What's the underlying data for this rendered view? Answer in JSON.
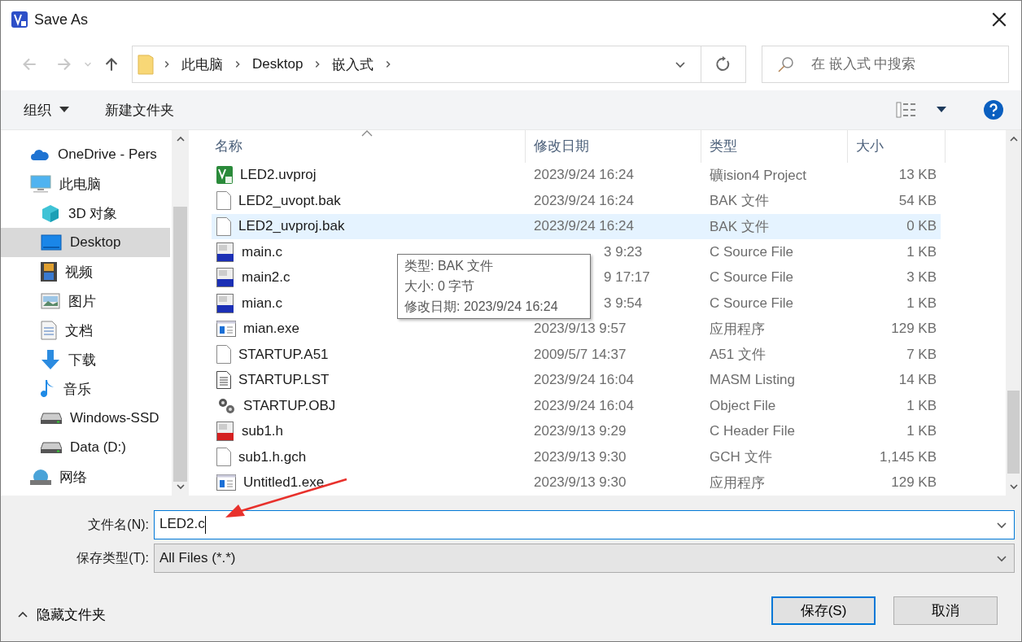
{
  "window": {
    "title": "Save As"
  },
  "address": {
    "path": [
      "此电脑",
      "Desktop",
      "嵌入式"
    ]
  },
  "search": {
    "placeholder": "在 嵌入式 中搜索"
  },
  "toolbar": {
    "organize": "组织",
    "new_folder": "新建文件夹"
  },
  "sidebar": {
    "items": [
      {
        "label": "OneDrive - Pers",
        "kind": "cloud",
        "selected": false
      },
      {
        "label": "此电脑",
        "kind": "pc",
        "selected": false,
        "children": [
          {
            "label": "3D 对象",
            "kind": "cube",
            "selected": false
          },
          {
            "label": "Desktop",
            "kind": "desktop",
            "selected": true
          },
          {
            "label": "视频",
            "kind": "video",
            "selected": false
          },
          {
            "label": "图片",
            "kind": "pictures",
            "selected": false
          },
          {
            "label": "文档",
            "kind": "documents",
            "selected": false
          },
          {
            "label": "下载",
            "kind": "download",
            "selected": false
          },
          {
            "label": "音乐",
            "kind": "music",
            "selected": false
          },
          {
            "label": "Windows-SSD",
            "kind": "drive",
            "selected": false
          },
          {
            "label": "Data (D:)",
            "kind": "drive",
            "selected": false
          }
        ]
      },
      {
        "label": "网络",
        "kind": "network",
        "selected": false
      }
    ]
  },
  "table": {
    "columns": [
      {
        "label": "名称",
        "sorted": true
      },
      {
        "label": "修改日期"
      },
      {
        "label": "类型"
      },
      {
        "label": "大小"
      }
    ],
    "rows": [
      {
        "name": "LED2.uvproj",
        "date": "2023/9/24 16:24",
        "type": "礦ision4 Project",
        "size": "13 KB",
        "kind": "project",
        "selected": false,
        "partly_hidden": false
      },
      {
        "name": "LED2_uvopt.bak",
        "date": "2023/9/24 16:24",
        "type": "BAK 文件",
        "size": "54 KB",
        "kind": "blank",
        "selected": false,
        "partly_hidden": false
      },
      {
        "name": "LED2_uvproj.bak",
        "date": "2023/9/24 16:24",
        "type": "BAK 文件",
        "size": "0 KB",
        "kind": "blank",
        "selected": true,
        "partly_hidden": false
      },
      {
        "name": "main.c",
        "date": "3 9:23",
        "type": "C Source File",
        "size": "1 KB",
        "kind": "source",
        "selected": false,
        "partly_hidden": true
      },
      {
        "name": "main2.c",
        "date": "9 17:17",
        "type": "C Source File",
        "size": "3 KB",
        "kind": "source",
        "selected": false,
        "partly_hidden": true
      },
      {
        "name": "mian.c",
        "date": "3 9:54",
        "type": "C Source File",
        "size": "1 KB",
        "kind": "source",
        "selected": false,
        "partly_hidden": true
      },
      {
        "name": "mian.exe",
        "date": "2023/9/13 9:57",
        "type": "应用程序",
        "size": "129 KB",
        "kind": "exe",
        "selected": false,
        "partly_hidden": false
      },
      {
        "name": "STARTUP.A51",
        "date": "2009/5/7 14:37",
        "type": "A51 文件",
        "size": "7 KB",
        "kind": "blank",
        "selected": false,
        "partly_hidden": false
      },
      {
        "name": "STARTUP.LST",
        "date": "2023/9/24 16:04",
        "type": "MASM Listing",
        "size": "14 KB",
        "kind": "listing",
        "selected": false,
        "partly_hidden": false
      },
      {
        "name": "STARTUP.OBJ",
        "date": "2023/9/24 16:04",
        "type": "Object File",
        "size": "1 KB",
        "kind": "object",
        "selected": false,
        "partly_hidden": false
      },
      {
        "name": "sub1.h",
        "date": "2023/9/13 9:29",
        "type": "C Header File",
        "size": "1 KB",
        "kind": "header",
        "selected": false,
        "partly_hidden": false
      },
      {
        "name": "sub1.h.gch",
        "date": "2023/9/13 9:30",
        "type": "GCH 文件",
        "size": "1,145 KB",
        "kind": "blank",
        "selected": false,
        "partly_hidden": false
      },
      {
        "name": "Untitled1.exe",
        "date": "2023/9/13 9:30",
        "type": "应用程序",
        "size": "129 KB",
        "kind": "exe",
        "selected": false,
        "partly_hidden": false
      }
    ]
  },
  "tooltip": {
    "lines": [
      "类型: BAK 文件",
      "大小: 0 字节",
      "修改日期: 2023/9/24 16:24"
    ]
  },
  "footer": {
    "filename": {
      "label": "文件名(N):",
      "value": "LED2.c"
    },
    "filetype": {
      "label": "保存类型(T):",
      "value": "All Files (*.*)"
    },
    "hide_folders": "隐藏文件夹",
    "buttons": [
      {
        "label": "保存(S)",
        "default": true
      },
      {
        "label": "取消",
        "default": false
      }
    ]
  }
}
